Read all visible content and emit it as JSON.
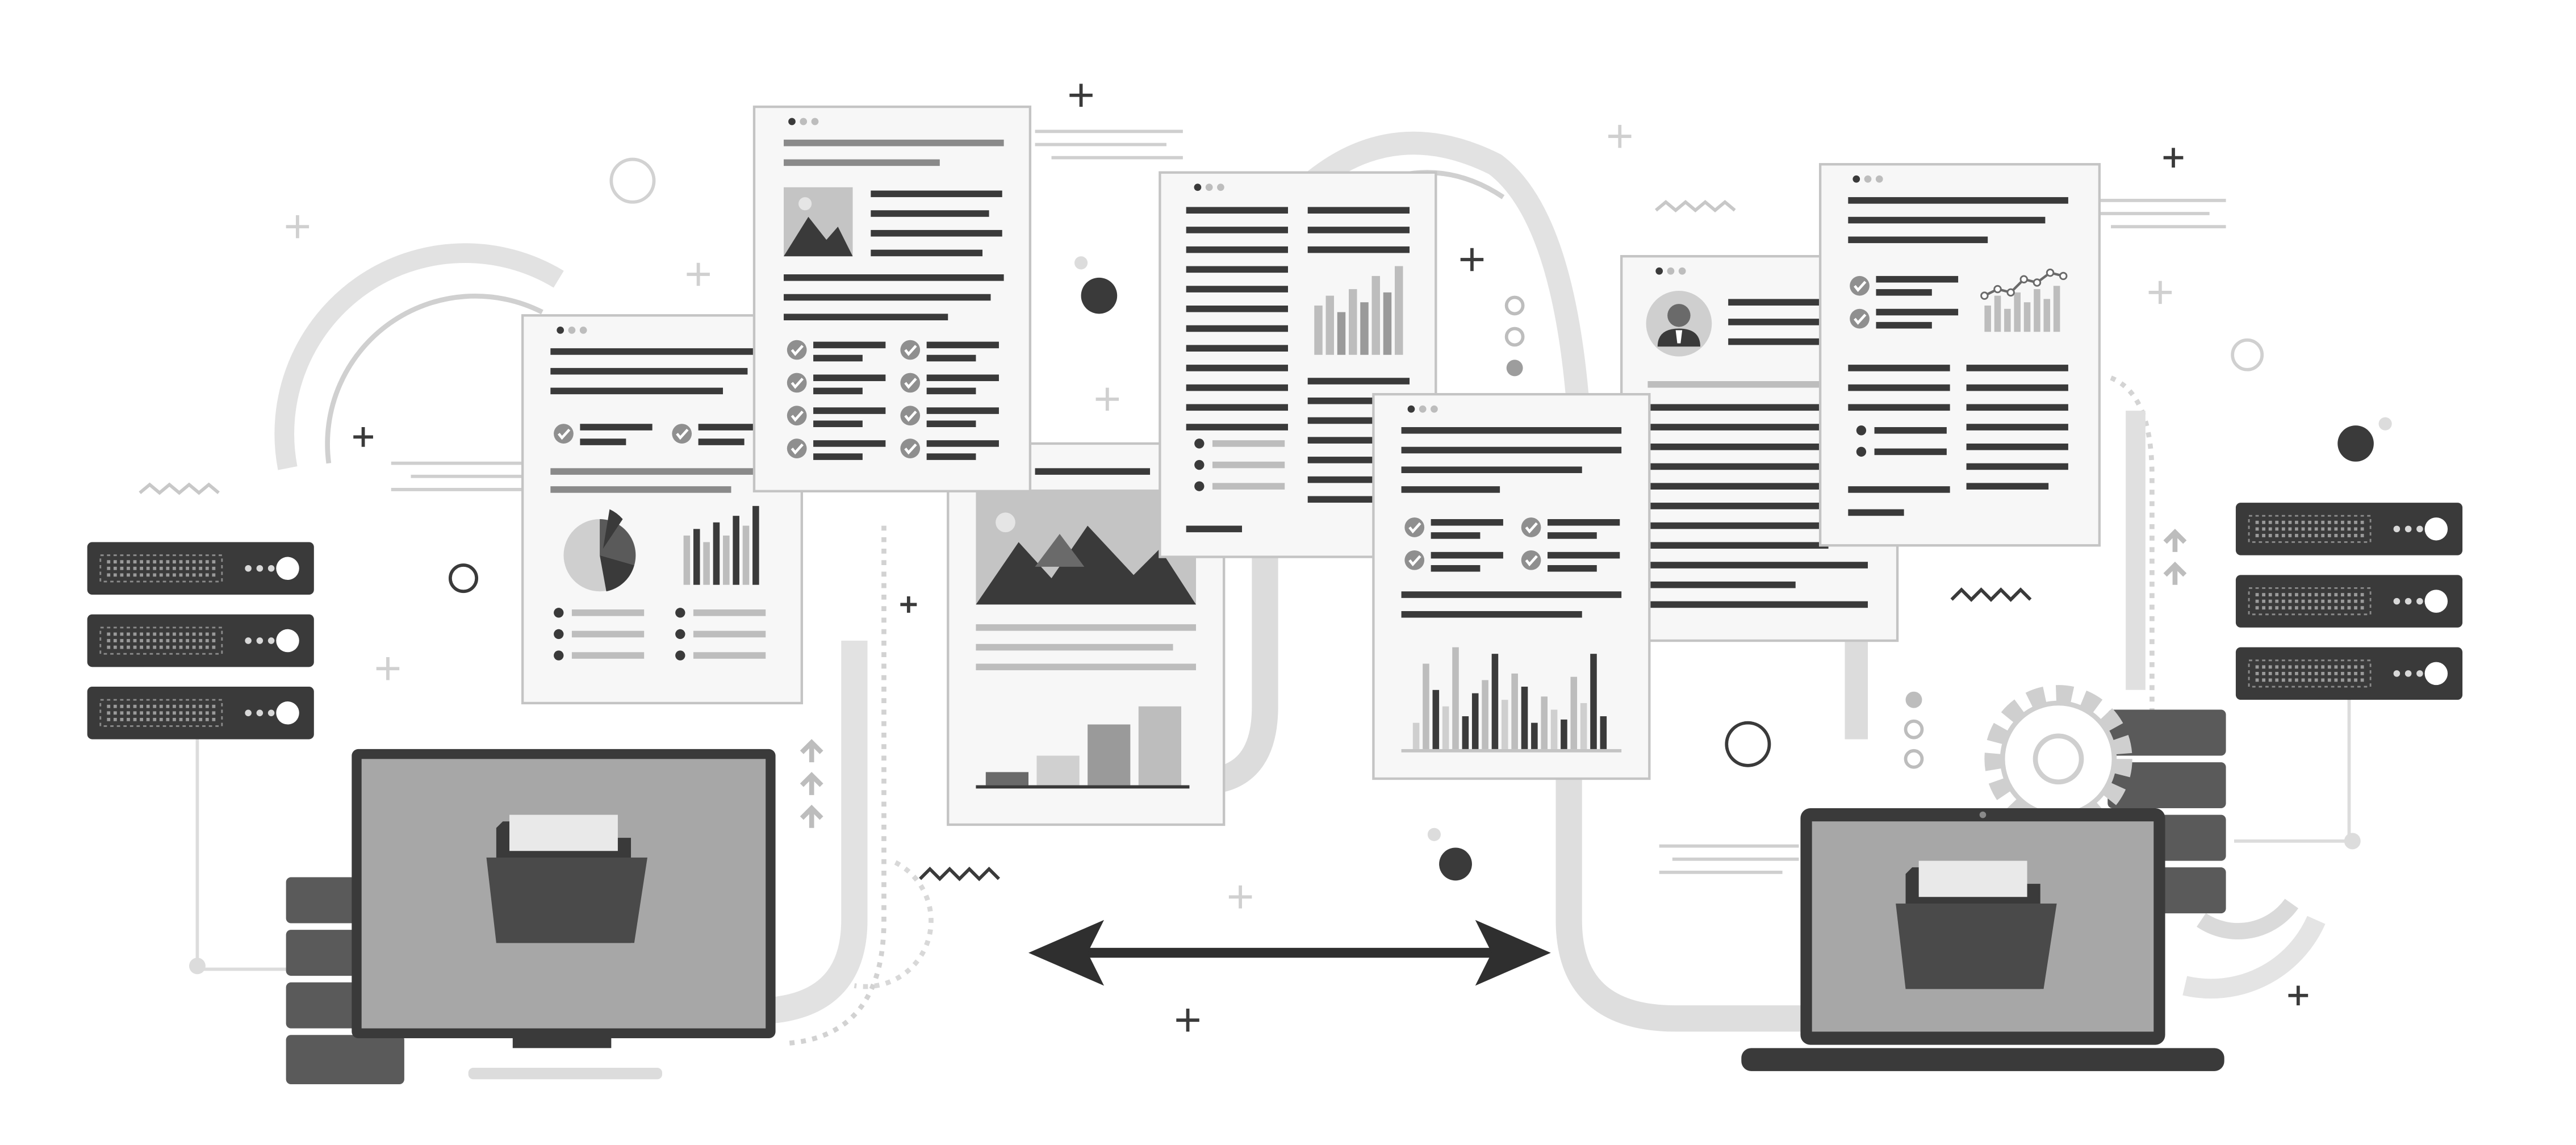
{
  "colors": {
    "background": "#ffffff",
    "paper": "#f7f7f7",
    "paper_border": "#c4c4c4",
    "dark": "#3a3a3a",
    "mid": "#7a7a7a",
    "light": "#c9c9c9",
    "pale": "#e3e3e3",
    "screen": "#a7a7a7"
  },
  "icons": [
    "server-rack-icon",
    "desktop-monitor-icon",
    "laptop-icon",
    "folder-icon",
    "document-icon",
    "bar-chart-icon",
    "pie-chart-icon",
    "line-chart-icon",
    "mountain-image-icon",
    "user-avatar-icon",
    "checkmark-icon",
    "gear-icon",
    "database-stack-icon",
    "double-arrow-icon",
    "upload-arrow-icon"
  ]
}
